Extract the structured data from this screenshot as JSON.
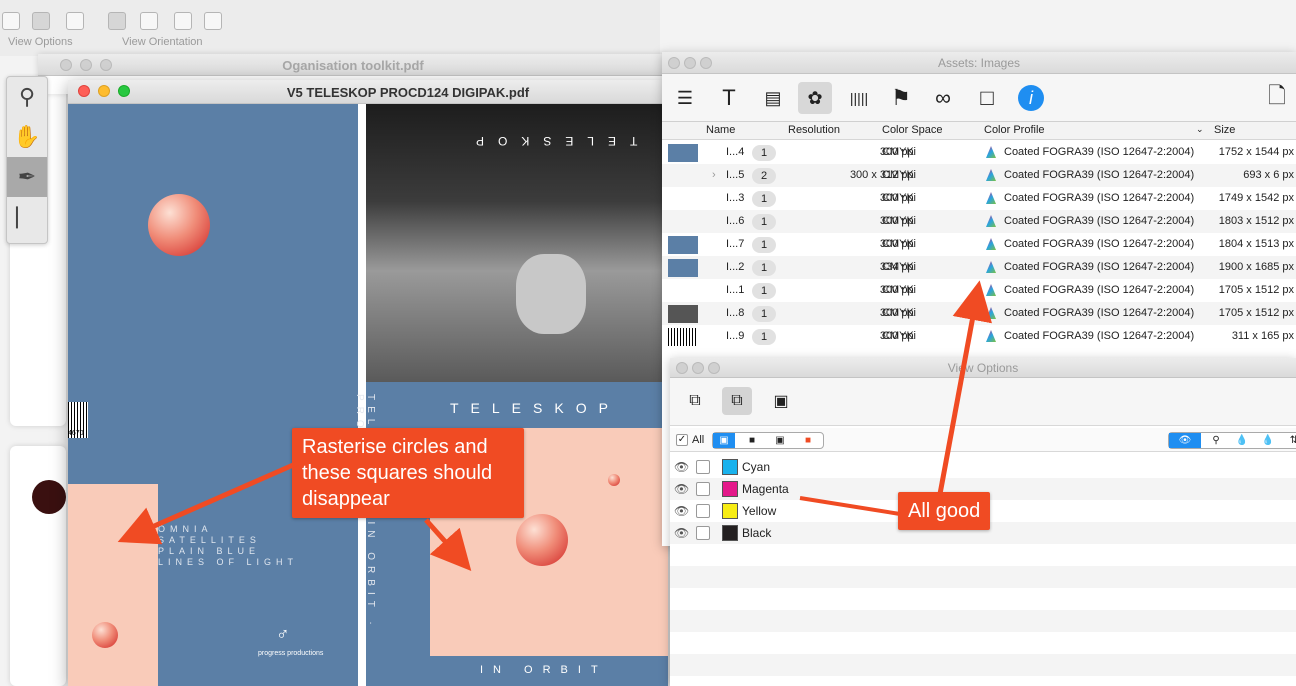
{
  "toolbar": {
    "view_options_label": "View Options",
    "view_orientation_label": "View Orientation"
  },
  "bg_window": {
    "title": "Oganisation toolkit.pdf"
  },
  "doc_window": {
    "title": "V5 TELESKOP PROCD124 DIGIPAK.pdf",
    "canvas": {
      "photo_title": "TELESKOP",
      "band_title": "TELESKOP",
      "bottom_title": "IN ORBIT",
      "spine_text": "TELESKOP · IN ORBIT · PROCD124",
      "left_lines": [
        "OMNIA",
        "SATELLITES",
        "PLAIN BLUE",
        "LINES OF LIGHT"
      ],
      "publisher": "progress productions",
      "barcode_number": "4670"
    }
  },
  "tools": [
    "zoom-icon",
    "hand-icon",
    "eyedropper-icon",
    "ruler-icon"
  ],
  "assets": {
    "title": "Assets: Images",
    "columns": [
      "Name",
      "Resolution",
      "Color Space",
      "Color Profile",
      "Size"
    ],
    "rows": [
      {
        "name": "I...4",
        "count": "1",
        "res": "300 ppi",
        "space": "CMYK",
        "profile": "Coated FOGRA39 (ISO 12647-2:2004)",
        "size": "1752 x 1544 px",
        "thumb": "#5b7fa6"
      },
      {
        "name": "I...5",
        "count": "2",
        "res": "300 x 312 ppi",
        "space": "CMYK",
        "profile": "Coated FOGRA39 (ISO 12647-2:2004)",
        "size": "693 x 6 px",
        "thumb": ""
      },
      {
        "name": "I...3",
        "count": "1",
        "res": "300 ppi",
        "space": "CMYK",
        "profile": "Coated FOGRA39 (ISO 12647-2:2004)",
        "size": "1749 x 1542 px",
        "thumb": ""
      },
      {
        "name": "I...6",
        "count": "1",
        "res": "300 ppi",
        "space": "CMYK",
        "profile": "Coated FOGRA39 (ISO 12647-2:2004)",
        "size": "1803 x 1512 px",
        "thumb": ""
      },
      {
        "name": "I...7",
        "count": "1",
        "res": "300 ppi",
        "space": "CMYK",
        "profile": "Coated FOGRA39 (ISO 12647-2:2004)",
        "size": "1804 x 1513 px",
        "thumb": "#5b7fa6"
      },
      {
        "name": "I...2",
        "count": "1",
        "res": "334 ppi",
        "space": "CMYK",
        "profile": "Coated FOGRA39 (ISO 12647-2:2004)",
        "size": "1900 x 1685 px",
        "thumb": "#5b7fa6"
      },
      {
        "name": "I...1",
        "count": "1",
        "res": "300 ppi",
        "space": "CMYK",
        "profile": "Coated FOGRA39 (ISO 12647-2:2004)",
        "size": "1705 x 1512 px",
        "thumb": ""
      },
      {
        "name": "I...8",
        "count": "1",
        "res": "300 ppi",
        "space": "CMYK",
        "profile": "Coated FOGRA39 (ISO 12647-2:2004)",
        "size": "1705 x 1512 px",
        "thumb": "#555"
      },
      {
        "name": "I...9",
        "count": "1",
        "res": "300 ppi",
        "space": "CMYK",
        "profile": "Coated FOGRA39 (ISO 12647-2:2004)",
        "size": "311 x 165 px",
        "thumb": "barcode"
      }
    ]
  },
  "view_options": {
    "title": "View Options",
    "all_label": "All",
    "separations": [
      {
        "name": "Cyan",
        "color": "#1ab2ec"
      },
      {
        "name": "Magenta",
        "color": "#e4198a"
      },
      {
        "name": "Yellow",
        "color": "#f7ec13"
      },
      {
        "name": "Black",
        "color": "#231f20"
      }
    ]
  },
  "annotations": {
    "left_callout": "Rasterise circles and these squares should disappear",
    "right_callout": "All good"
  },
  "colors": {
    "accent_red": "#f04b23",
    "doc_blue": "#5b7fa6",
    "peach": "#f9cbb9"
  }
}
